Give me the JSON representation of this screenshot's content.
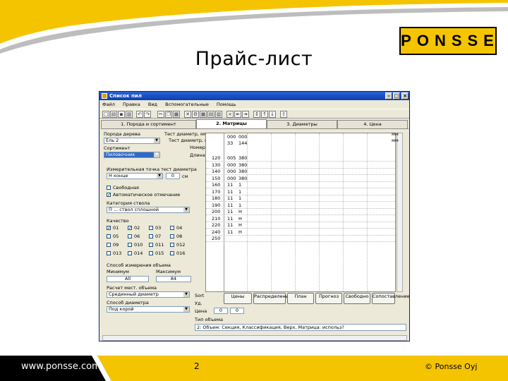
{
  "slide": {
    "title": "Прайс-лист",
    "logo_text": "PONSSE",
    "footer_url": "www.ponsse.com",
    "page_number": "2",
    "copyright": "© Ponsse Oyj",
    "colors": {
      "brand_yellow": "#f5c400",
      "brand_black": "#000000"
    }
  },
  "window": {
    "title": "Список пил",
    "menu": [
      "Файл",
      "Правка",
      "Вид",
      "Вспомогательные",
      "Помощь"
    ],
    "tabs": [
      "1. Порода и сортимент",
      "2. Матрицы",
      "3. Диаметры",
      "4. Цена"
    ],
    "left_panel": {
      "species_label": "Порода дерева",
      "species_value": "Ель 2",
      "assortment_label": "Сортимент",
      "assortment_value": "Пиловочник",
      "measure_label": "Измерительная точка тест диаметра",
      "measure_value": "Н конце",
      "measure_offset": "0",
      "measure_unit": "см",
      "checks": [
        {
          "label": "Свободная",
          "checked": false
        },
        {
          "label": "Автоматическое отмечание",
          "checked": true
        }
      ],
      "category_label": "Категория ствола",
      "category_value": "П ... ствол сплошной",
      "quality_label": "Качество",
      "qualities": [
        {
          "label": "01",
          "checked": true
        },
        {
          "label": "02",
          "checked": true
        },
        {
          "label": "03",
          "checked": false
        },
        {
          "label": "04",
          "checked": false
        },
        {
          "label": "05",
          "checked": false
        },
        {
          "label": "06",
          "checked": false
        },
        {
          "label": "07",
          "checked": false
        },
        {
          "label": "08",
          "checked": false
        },
        {
          "label": "09",
          "checked": false
        },
        {
          "label": "010",
          "checked": false
        },
        {
          "label": "011",
          "checked": false
        },
        {
          "label": "012",
          "checked": false
        },
        {
          "label": "013",
          "checked": false
        },
        {
          "label": "014",
          "checked": false
        },
        {
          "label": "015",
          "checked": false
        },
        {
          "label": "016",
          "checked": false
        }
      ],
      "method_label": "Способ измерения объема",
      "min_label": "Минимум",
      "max_label": "Максимум",
      "min_value": "All",
      "max_value": "84",
      "calc_label": "Расчет мест. объема",
      "calc_value": "Срединный диаметр",
      "diameter_label": "Способ диаметра",
      "diameter_value": "Под корой"
    },
    "matrix": {
      "row_label_test": "Тест диаметр, мм",
      "row_label_test2": "Тест диаметр, мм",
      "row_label_num": "Номер",
      "row_label_len": "Длина",
      "top_values": [
        "000",
        "000",
        "33",
        "144"
      ],
      "header_cols": [
        "мм",
        "мм"
      ],
      "lengths": [
        "120",
        "130",
        "140",
        "150",
        "160",
        "170",
        "180",
        "190",
        "200",
        "210",
        "220",
        "240",
        "250"
      ],
      "col1": [
        "005",
        "000",
        "000",
        "000",
        "11",
        "11",
        "11",
        "11",
        "11",
        "11",
        "11",
        "11",
        ""
      ],
      "col2": [
        "380",
        "380",
        "380",
        "380",
        "1",
        "1",
        "1",
        "1",
        "Н",
        "Н",
        "Н",
        "Н",
        ""
      ]
    },
    "buttons": [
      "Цены",
      "Распределение",
      "План",
      "Прогноз",
      "Свободно",
      "Сопоставление"
    ],
    "bottom_fields": {
      "sort_label": "Sort",
      "val_label": "Уд.",
      "price_label": "Цена",
      "a_value": "0",
      "b_value": "0"
    },
    "text_label": "Тип объема",
    "status_text": "2: Объем: Секция, Классификация, Верх, Матрица: использ?"
  }
}
